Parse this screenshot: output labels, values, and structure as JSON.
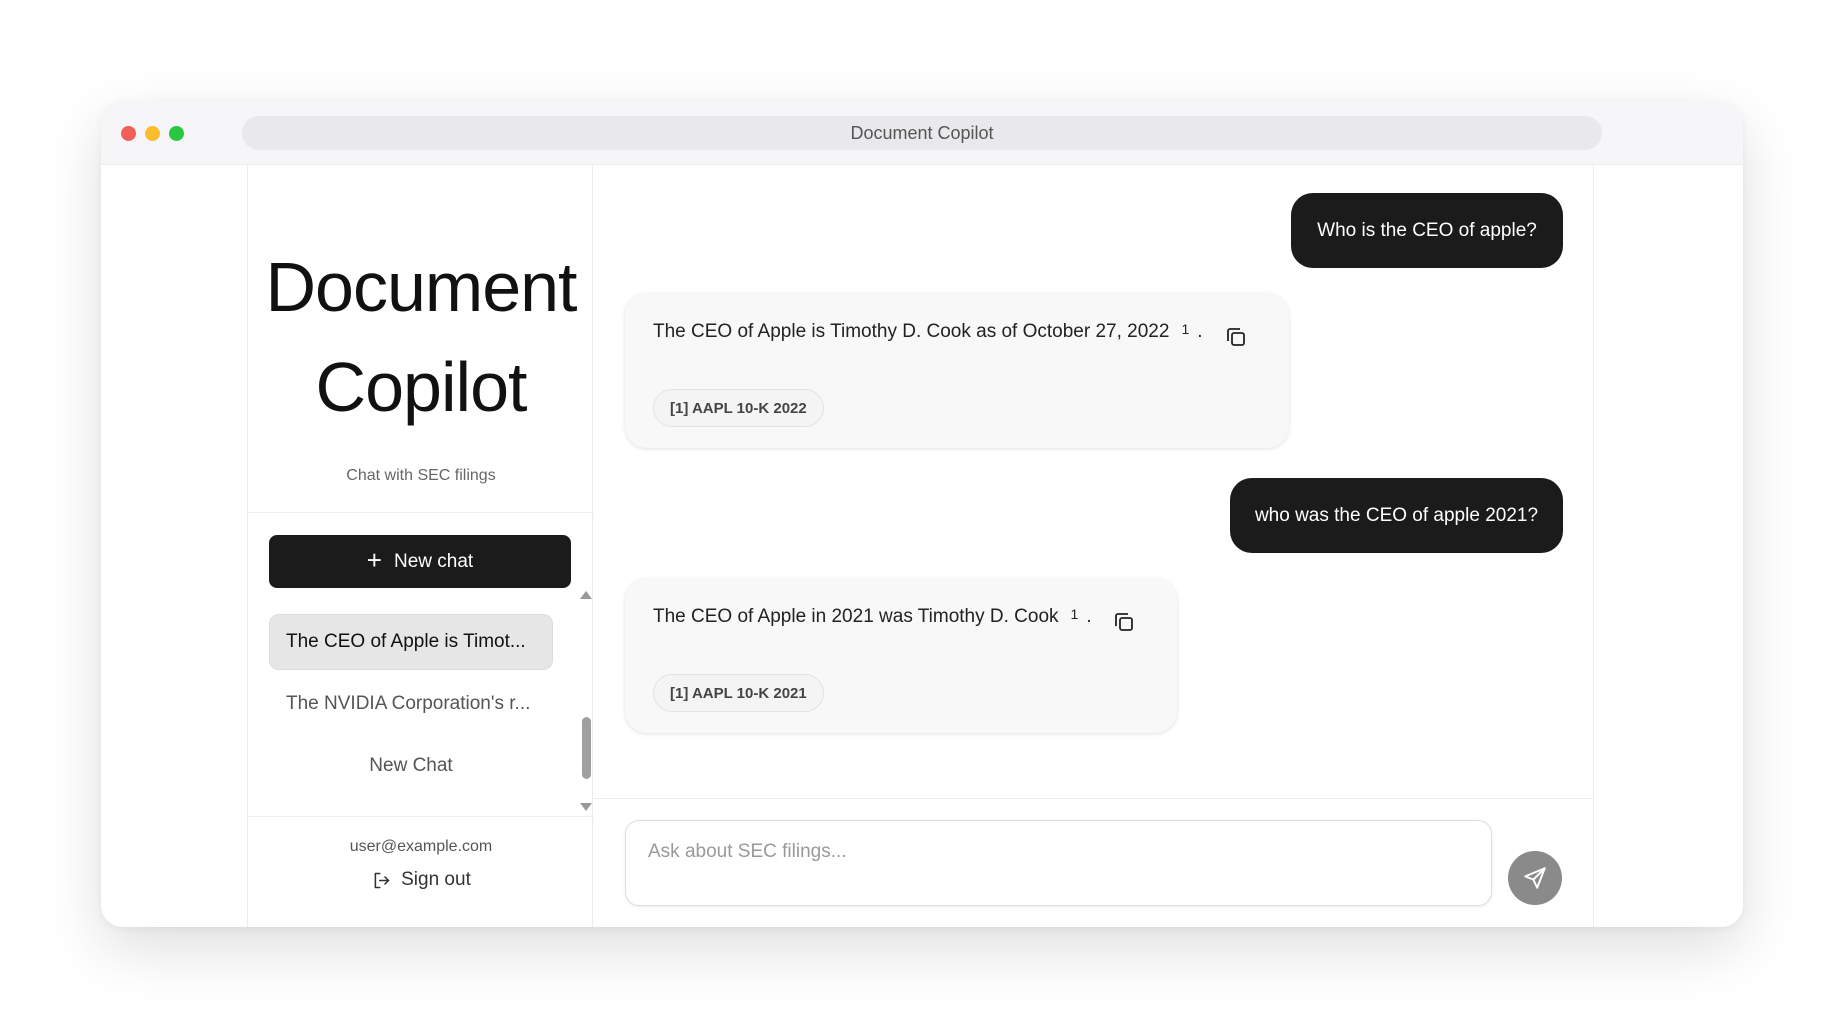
{
  "window": {
    "title": "Document Copilot"
  },
  "sidebar": {
    "brand": "Document Copilot",
    "tagline": "Chat with SEC filings",
    "new_chat_label": "New chat",
    "chats": [
      {
        "label": "The CEO of Apple is Timot...",
        "active": true
      },
      {
        "label": "The NVIDIA Corporation's r...",
        "active": false
      },
      {
        "label": "New Chat",
        "active": false
      }
    ],
    "user_email": "user@example.com",
    "sign_out_label": "Sign out"
  },
  "conversation": {
    "messages": [
      {
        "role": "user",
        "text": "Who is the CEO of apple?"
      },
      {
        "role": "assistant",
        "text": "The CEO of Apple is Timothy D. Cook as of October 27, 2022",
        "citation": "1",
        "trailing": ".",
        "source": "[1] AAPL 10-K 2022"
      },
      {
        "role": "user",
        "text": "who was the CEO of apple 2021?"
      },
      {
        "role": "assistant",
        "text": "The CEO of Apple in 2021 was Timothy D. Cook",
        "citation": "1",
        "trailing": ".",
        "source": "[1] AAPL 10-K 2021"
      }
    ]
  },
  "composer": {
    "placeholder": "Ask about SEC filings..."
  },
  "icons": {
    "plus": "plus-icon",
    "sign_out": "sign-out-icon",
    "copy": "copy-icon",
    "send": "send-icon"
  },
  "colors": {
    "primary": "#1b1b1b",
    "send_button": "#8a8a8a",
    "active_chat": "#e6e6e6"
  }
}
